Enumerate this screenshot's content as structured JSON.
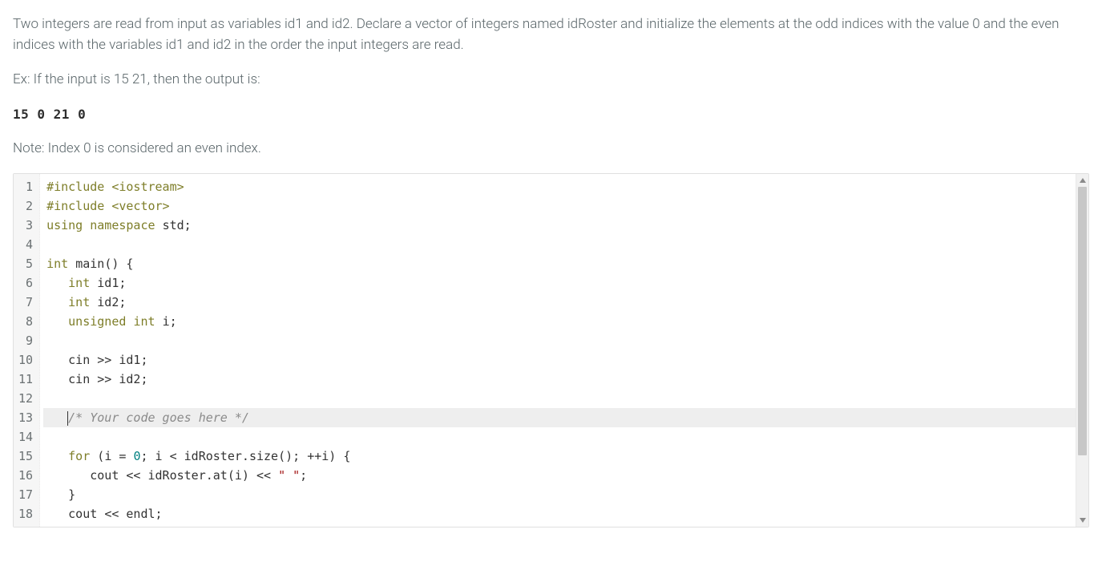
{
  "problem": {
    "description": "Two integers are read from input as variables id1 and id2. Declare a vector of integers named idRoster and initialize the elements at the odd indices with the value 0 and the even indices with the variables id1 and id2 in the order the input integers are read.",
    "example_label": "Ex: If the input is 15 21, then the output is:",
    "example_output": "15 0 21 0",
    "note": "Note: Index 0 is considered an even index."
  },
  "editor": {
    "line_numbers": [
      "1",
      "2",
      "3",
      "4",
      "5",
      "6",
      "7",
      "8",
      "9",
      "10",
      "11",
      "12",
      "13",
      "14",
      "15",
      "16",
      "17",
      "18"
    ],
    "highlight_line_index": 12,
    "lines": [
      [
        {
          "t": "#include ",
          "c": "tok-pp"
        },
        {
          "t": "<iostream>",
          "c": "tok-pp"
        }
      ],
      [
        {
          "t": "#include ",
          "c": "tok-pp"
        },
        {
          "t": "<vector>",
          "c": "tok-pp"
        }
      ],
      [
        {
          "t": "using ",
          "c": "tok-kw"
        },
        {
          "t": "namespace ",
          "c": "tok-kw"
        },
        {
          "t": "std",
          "c": "tok-id"
        },
        {
          "t": ";",
          "c": "tok-punct"
        }
      ],
      [],
      [
        {
          "t": "int ",
          "c": "tok-type"
        },
        {
          "t": "main",
          "c": "tok-id"
        },
        {
          "t": "() {",
          "c": "tok-punct"
        }
      ],
      [
        {
          "t": "   ",
          "c": ""
        },
        {
          "t": "int ",
          "c": "tok-type"
        },
        {
          "t": "id1",
          "c": "tok-id"
        },
        {
          "t": ";",
          "c": "tok-punct"
        }
      ],
      [
        {
          "t": "   ",
          "c": ""
        },
        {
          "t": "int ",
          "c": "tok-type"
        },
        {
          "t": "id2",
          "c": "tok-id"
        },
        {
          "t": ";",
          "c": "tok-punct"
        }
      ],
      [
        {
          "t": "   ",
          "c": ""
        },
        {
          "t": "unsigned ",
          "c": "tok-type"
        },
        {
          "t": "int ",
          "c": "tok-type"
        },
        {
          "t": "i",
          "c": "tok-id"
        },
        {
          "t": ";",
          "c": "tok-punct"
        }
      ],
      [],
      [
        {
          "t": "   ",
          "c": ""
        },
        {
          "t": "cin ",
          "c": "tok-id"
        },
        {
          "t": ">> ",
          "c": "tok-op"
        },
        {
          "t": "id1",
          "c": "tok-id"
        },
        {
          "t": ";",
          "c": "tok-punct"
        }
      ],
      [
        {
          "t": "   ",
          "c": ""
        },
        {
          "t": "cin ",
          "c": "tok-id"
        },
        {
          "t": ">> ",
          "c": "tok-op"
        },
        {
          "t": "id2",
          "c": "tok-id"
        },
        {
          "t": ";",
          "c": "tok-punct"
        }
      ],
      [],
      [
        {
          "t": "   ",
          "c": ""
        },
        {
          "t": "/* Your code goes here */",
          "c": "tok-cmt",
          "caret_before": true
        }
      ],
      [],
      [
        {
          "t": "   ",
          "c": ""
        },
        {
          "t": "for ",
          "c": "tok-kw"
        },
        {
          "t": "(",
          "c": "tok-punct"
        },
        {
          "t": "i ",
          "c": "tok-id"
        },
        {
          "t": "= ",
          "c": "tok-op"
        },
        {
          "t": "0",
          "c": "tok-num"
        },
        {
          "t": "; ",
          "c": "tok-punct"
        },
        {
          "t": "i ",
          "c": "tok-id"
        },
        {
          "t": "< ",
          "c": "tok-op"
        },
        {
          "t": "idRoster",
          "c": "tok-id"
        },
        {
          "t": ".",
          "c": "tok-punct"
        },
        {
          "t": "size",
          "c": "tok-id"
        },
        {
          "t": "(); ",
          "c": "tok-punct"
        },
        {
          "t": "++",
          "c": "tok-op"
        },
        {
          "t": "i",
          "c": "tok-id"
        },
        {
          "t": ") {",
          "c": "tok-punct"
        }
      ],
      [
        {
          "t": "      ",
          "c": ""
        },
        {
          "t": "cout ",
          "c": "tok-id"
        },
        {
          "t": "<< ",
          "c": "tok-op"
        },
        {
          "t": "idRoster",
          "c": "tok-id"
        },
        {
          "t": ".",
          "c": "tok-punct"
        },
        {
          "t": "at",
          "c": "tok-id"
        },
        {
          "t": "(",
          "c": "tok-punct"
        },
        {
          "t": "i",
          "c": "tok-id"
        },
        {
          "t": ") ",
          "c": "tok-punct"
        },
        {
          "t": "<< ",
          "c": "tok-op"
        },
        {
          "t": "\" \"",
          "c": "tok-str"
        },
        {
          "t": ";",
          "c": "tok-punct"
        }
      ],
      [
        {
          "t": "   ",
          "c": ""
        },
        {
          "t": "}",
          "c": "tok-punct"
        }
      ],
      [
        {
          "t": "   ",
          "c": ""
        },
        {
          "t": "cout ",
          "c": "tok-id"
        },
        {
          "t": "<< ",
          "c": "tok-op"
        },
        {
          "t": "endl",
          "c": "tok-id"
        },
        {
          "t": ";",
          "c": "tok-punct"
        }
      ]
    ]
  }
}
